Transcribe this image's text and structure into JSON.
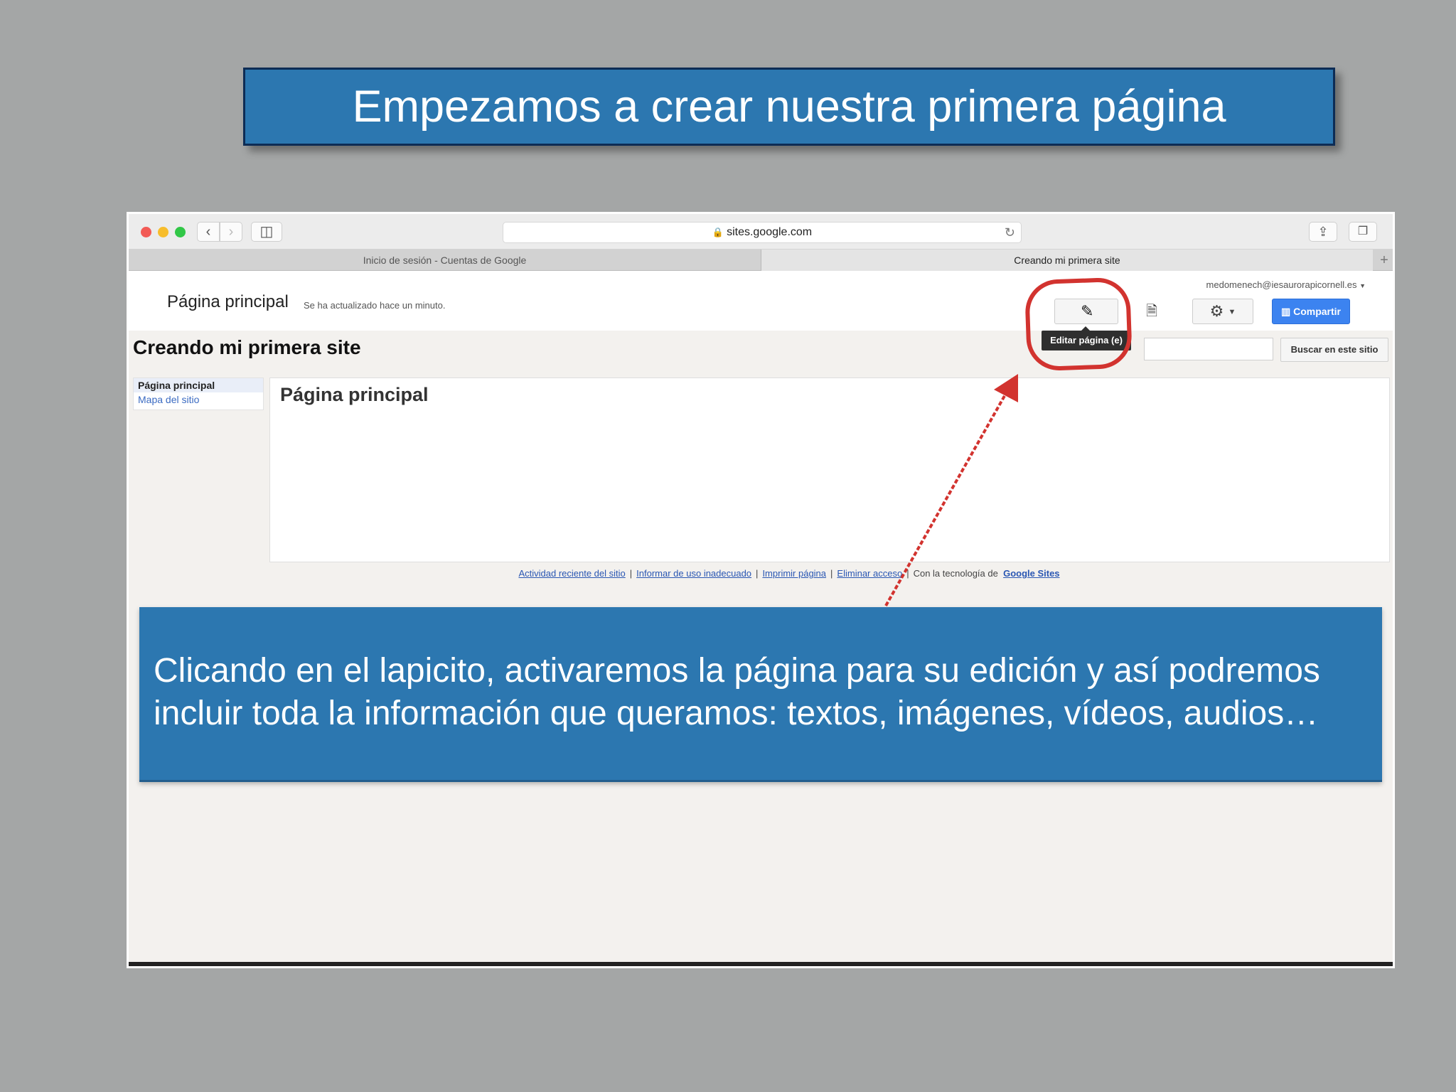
{
  "slide": {
    "title": "Empezamos a crear nuestra primera página",
    "caption": "Clicando en el lapicito, activaremos la página para su edición y así podremos incluir toda la información que queramos: textos, imágenes, vídeos, audios…"
  },
  "browser": {
    "url": "sites.google.com",
    "tabs": [
      {
        "label": "Inicio de sesión - Cuentas de Google"
      },
      {
        "label": "Creando mi primera site"
      }
    ]
  },
  "site": {
    "page_heading": "Página principal",
    "updated_text": "Se ha actualizado hace un minuto.",
    "account": "medomenech@iesaurorapicornell.es",
    "edit_tooltip": "Editar página (e)",
    "share_label": "Compartir",
    "site_title": "Creando mi primera site",
    "search_button": "Buscar en este sitio",
    "search_placeholder": "",
    "sidenav": {
      "active": "Página principal",
      "link": "Mapa del sitio"
    },
    "content_title": "Página principal",
    "footer": {
      "links": [
        "Actividad reciente del sitio",
        "Informar de uso inadecuado",
        "Imprimir página",
        "Eliminar acceso"
      ],
      "powered_by": "Con la tecnología de",
      "brand": "Google Sites"
    }
  },
  "colors": {
    "slide_background": "#a4a6a6",
    "banner_blue": "#2c77b0",
    "annotation_red": "#d2332f",
    "share_blue": "#3c83f0"
  },
  "icons": {
    "edit": "pencil-icon",
    "new_page": "new-page-icon",
    "settings": "gear-icon",
    "share": "share-icon",
    "lock": "lock-icon",
    "reload": "reload-icon"
  }
}
